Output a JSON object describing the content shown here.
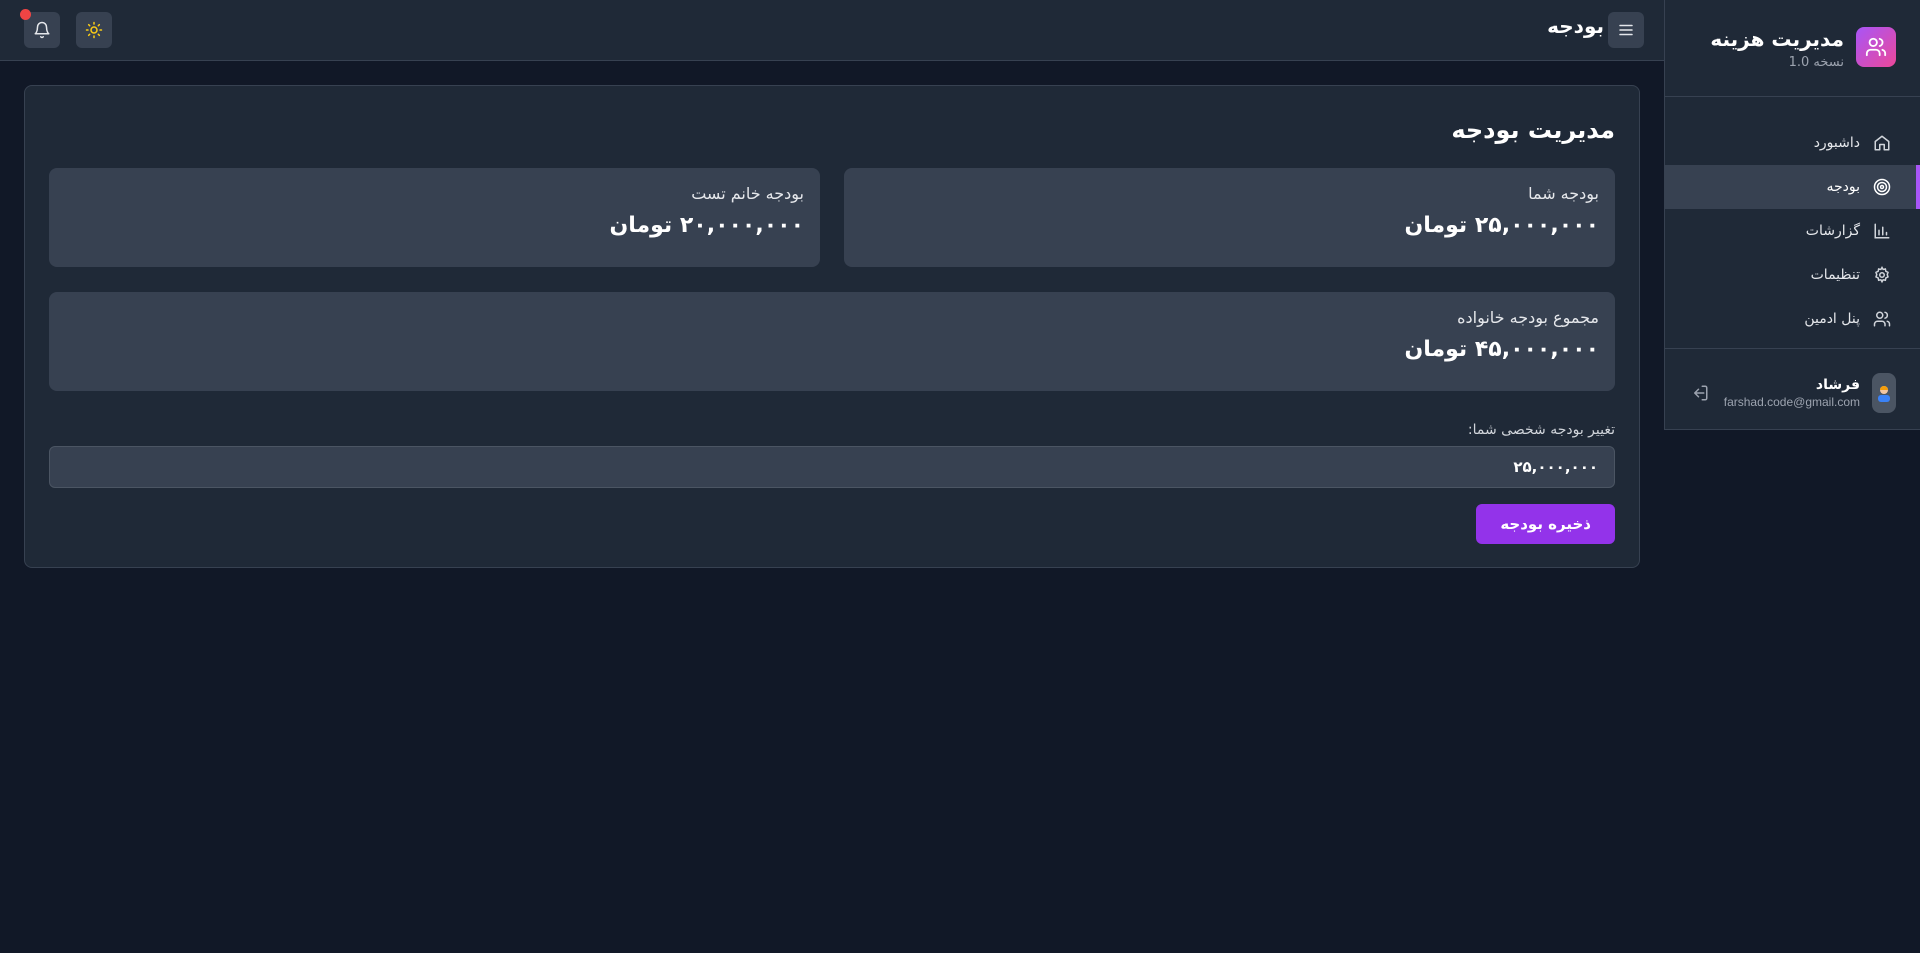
{
  "header": {
    "title": "بودجه",
    "menu_icon": "menu-icon",
    "theme_icon": "sun-icon",
    "bell_icon": "bell-icon"
  },
  "sidebar": {
    "brand_title": "مدیریت هزینه",
    "brand_version": "نسخه 1.0",
    "brand_icon": "users-icon",
    "items": [
      {
        "label": "داشبورد",
        "icon": "home-icon",
        "active": false
      },
      {
        "label": "بودجه",
        "icon": "target-icon",
        "active": true
      },
      {
        "label": "گزارشات",
        "icon": "bar-chart-icon",
        "active": false
      },
      {
        "label": "تنظیمات",
        "icon": "gear-icon",
        "active": false
      },
      {
        "label": "پنل ادمین",
        "icon": "users-icon",
        "active": false
      }
    ],
    "user": {
      "name": "فرشاد",
      "email": "farshad.code@gmail.com",
      "logout_icon": "logout-icon"
    }
  },
  "main": {
    "title": "مدیریت بودجه",
    "your_budget": {
      "label": "بودجه شما",
      "value": "۲۵,۰۰۰,۰۰۰ تومان"
    },
    "partner_budget": {
      "label": "بودجه خانم تست",
      "value": "۲۰,۰۰۰,۰۰۰ تومان"
    },
    "family_total": {
      "label": "مجموع بودجه خانواده",
      "value": "۴۵,۰۰۰,۰۰۰ تومان"
    },
    "change_label": "تغییر بودجه شخصی شما:",
    "input_value": "۲۵,۰۰۰,۰۰۰",
    "save_label": "ذخیره بودجه"
  },
  "colors": {
    "accent": "#9333ea",
    "background": "#111827",
    "panel": "#1f2937",
    "card": "#374151",
    "notification": "#ef4444"
  }
}
